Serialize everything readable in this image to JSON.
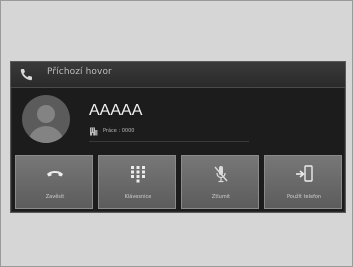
{
  "header": {
    "icon": "phone-icon",
    "title": "Příchozí hovor"
  },
  "caller": {
    "avatar_icon": "person-avatar-icon",
    "name": "AAAAA",
    "sub_icon": "building-icon",
    "sub_text": "Práce : 0000"
  },
  "actions": [
    {
      "icon": "hang-up-icon",
      "label": "Zavěsit"
    },
    {
      "icon": "keypad-icon",
      "label": "Klávesnice"
    },
    {
      "icon": "mute-microphone-icon",
      "label": "Ztlumit"
    },
    {
      "icon": "transfer-to-phone-icon",
      "label": "Použít telefon"
    }
  ],
  "colors": {
    "screen_bg": "#1c1c1c",
    "button_bg": "#6a6a6a",
    "text": "#f2f2f2"
  }
}
